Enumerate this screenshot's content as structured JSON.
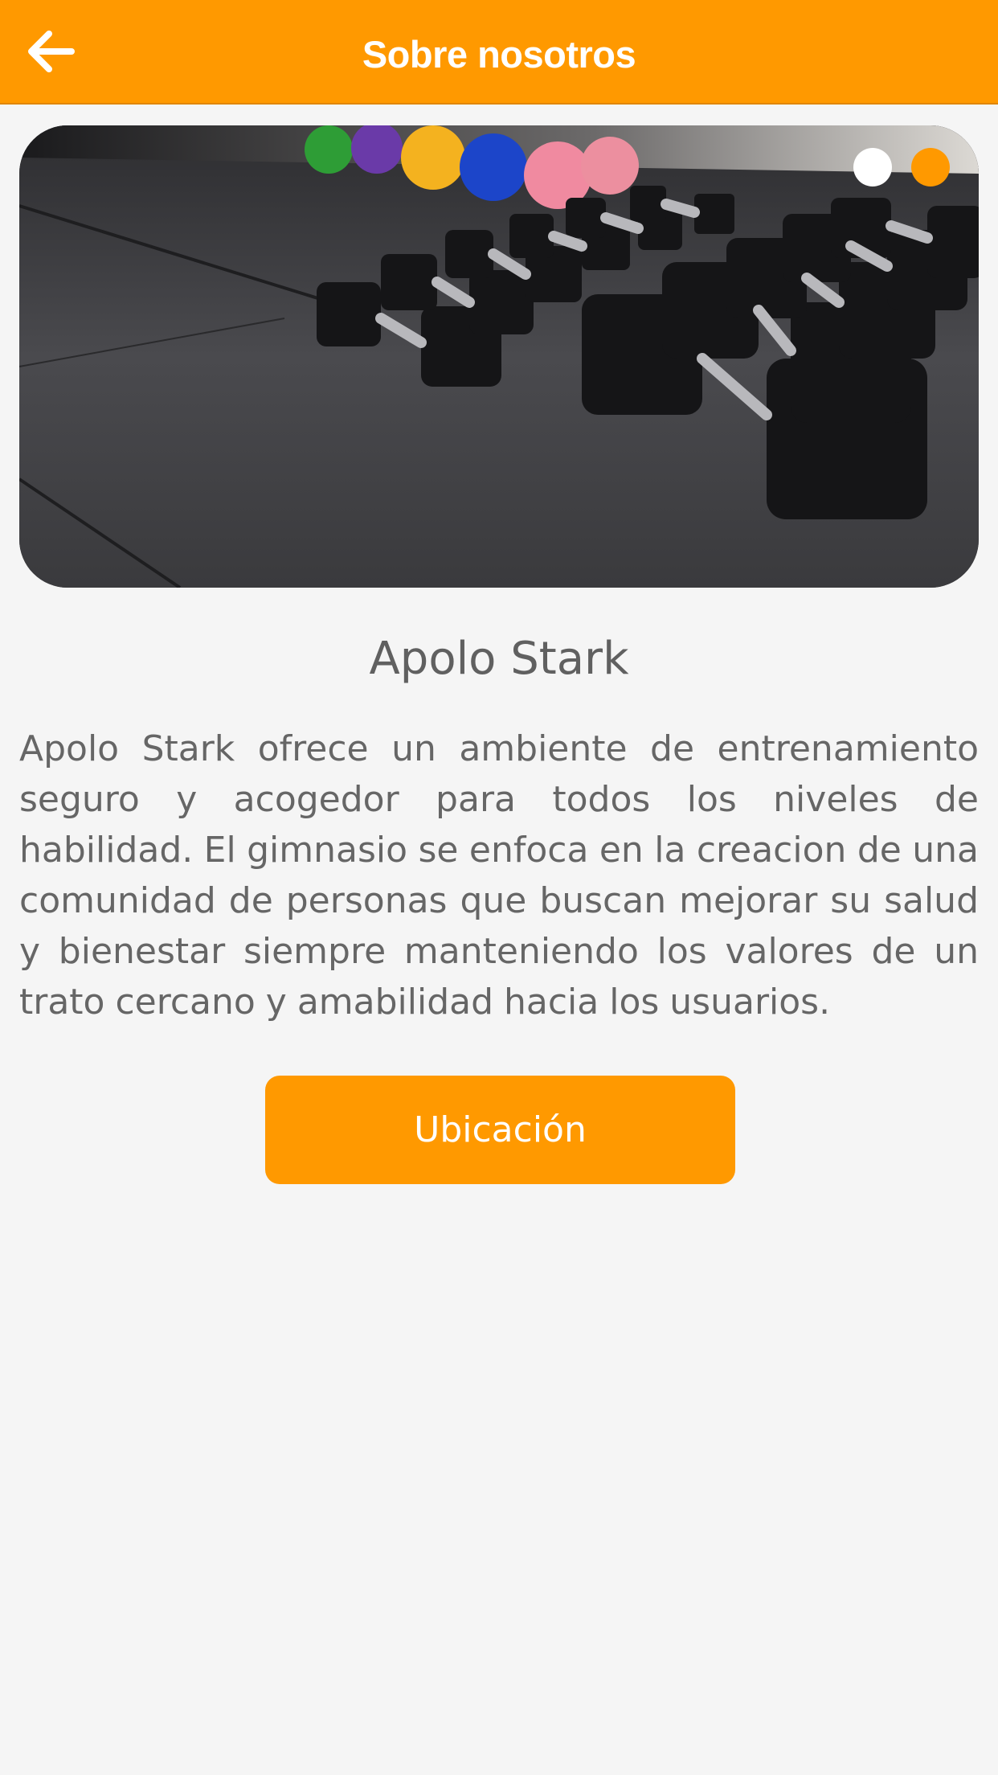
{
  "header": {
    "title": "Sobre nosotros",
    "back_icon": "arrow-left-icon"
  },
  "carousel": {
    "image": "gym-dumbbells-photo",
    "slide_count": 2,
    "active_slide": 1,
    "dots": [
      {
        "color": "#ffffff"
      },
      {
        "color": "#ff9900"
      }
    ]
  },
  "main": {
    "name": "Apolo Stark",
    "description": "Apolo Stark ofrece un ambiente de entrenamiento seguro y acogedor para todos los niveles de habilidad. El gimnasio se enfoca en la creacion de una comunidad de personas que buscan mejorar su salud y bienestar siempre manteniendo los valores de un trato cercano y amabilidad hacia los usuarios.",
    "location_button": "Ubicación"
  },
  "colors": {
    "accent": "#ff9900",
    "background": "#f5f5f5",
    "text": "#666666"
  }
}
